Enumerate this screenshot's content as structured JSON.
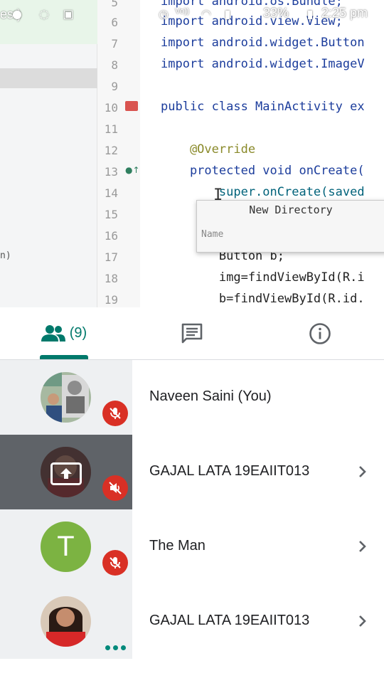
{
  "status_bar": {
    "left_text": "es:)",
    "battery": "33%",
    "time": "2:25 pm",
    "signal_label": "Vo))"
  },
  "shared_screen": {
    "left_fragment": "n)",
    "code_lines": [
      {
        "num": "5",
        "text": "import android.os.Bundle;"
      },
      {
        "num": "6",
        "text": "import android.view.View;"
      },
      {
        "num": "7",
        "text": "import android.widget.Button"
      },
      {
        "num": "8",
        "text": "import android.widget.ImageV"
      },
      {
        "num": "9",
        "text": ""
      },
      {
        "num": "10",
        "text": "public class MainActivity ex"
      },
      {
        "num": "11",
        "text": ""
      },
      {
        "num": "12",
        "text": "    @Override"
      },
      {
        "num": "13",
        "text": "    protected void onCreate("
      },
      {
        "num": "14",
        "text": "        super.onCreate(saved"
      },
      {
        "num": "15",
        "text": ""
      },
      {
        "num": "16",
        "text": ""
      },
      {
        "num": "17",
        "text": "        Button b;"
      },
      {
        "num": "18",
        "text": "        img=findViewById(R.i"
      },
      {
        "num": "19",
        "text": "        b=findViewById(R.id."
      }
    ],
    "dialog": {
      "title": "New Directory",
      "input_placeholder": "Name"
    }
  },
  "tabs": {
    "people_count": "(9)",
    "chat_icon": "chat-icon",
    "info_icon": "info-icon",
    "active": "people"
  },
  "participants": [
    {
      "name": "Naveen Saini (You)",
      "avatar": "photo",
      "mic": "muted",
      "chevron": false
    },
    {
      "name": "GAJAL LATA 19EAIIT013",
      "avatar": "presenting",
      "mic": "audio-muted",
      "chevron": true
    },
    {
      "name": "The Man",
      "avatar": "letter",
      "letter": "T",
      "avatar_color": "#7cb342",
      "mic": "muted",
      "chevron": true
    },
    {
      "name": "GAJAL LATA 19EAIIT013",
      "avatar": "photo",
      "mic": "speaking",
      "chevron": true
    }
  ],
  "colors": {
    "accent": "#00796b",
    "mute_red": "#d93025",
    "active_tile": "#5f6368",
    "tile": "#eef0f2"
  }
}
